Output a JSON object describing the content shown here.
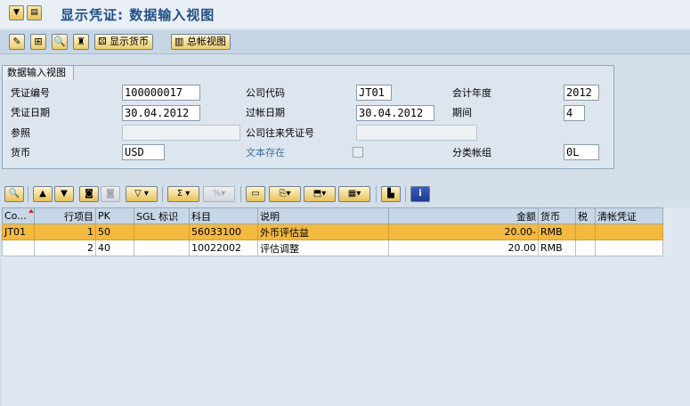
{
  "title": "显示凭证: 数据输入视图",
  "toolbar": {
    "display_currency": "显示货币",
    "general_ledger": "总帐视图"
  },
  "group": {
    "title": "数据输入视图",
    "doc_number_label": "凭证编号",
    "doc_number": "100000017",
    "company_code_label": "公司代码",
    "company_code": "JT01",
    "fiscal_year_label": "会计年度",
    "fiscal_year": "2012",
    "doc_date_label": "凭证日期",
    "doc_date": "30.04.2012",
    "posting_date_label": "过帐日期",
    "posting_date": "30.04.2012",
    "period_label": "期间",
    "period": "4",
    "reference_label": "参照",
    "reference": "",
    "intercompany_label": "公司往来凭证号",
    "intercompany": "",
    "currency_label": "货币",
    "currency": "USD",
    "text_exists_label": "文本存在",
    "ledger_group_label": "分类帐组",
    "ledger_group": "0L"
  },
  "table": {
    "headers": [
      "Co...",
      "行项目",
      "PK",
      "SGL 标识",
      "科目",
      "说明",
      "金额",
      "货币",
      "税",
      "清帐凭证"
    ],
    "rows": [
      [
        "JT01",
        "1",
        "50",
        "",
        "56033100",
        "外币评估益",
        "20.00-",
        "RMB",
        "",
        ""
      ],
      [
        "",
        "2",
        "40",
        "",
        "10022002",
        "评估调整",
        "20.00",
        "RMB",
        "",
        ""
      ]
    ]
  }
}
